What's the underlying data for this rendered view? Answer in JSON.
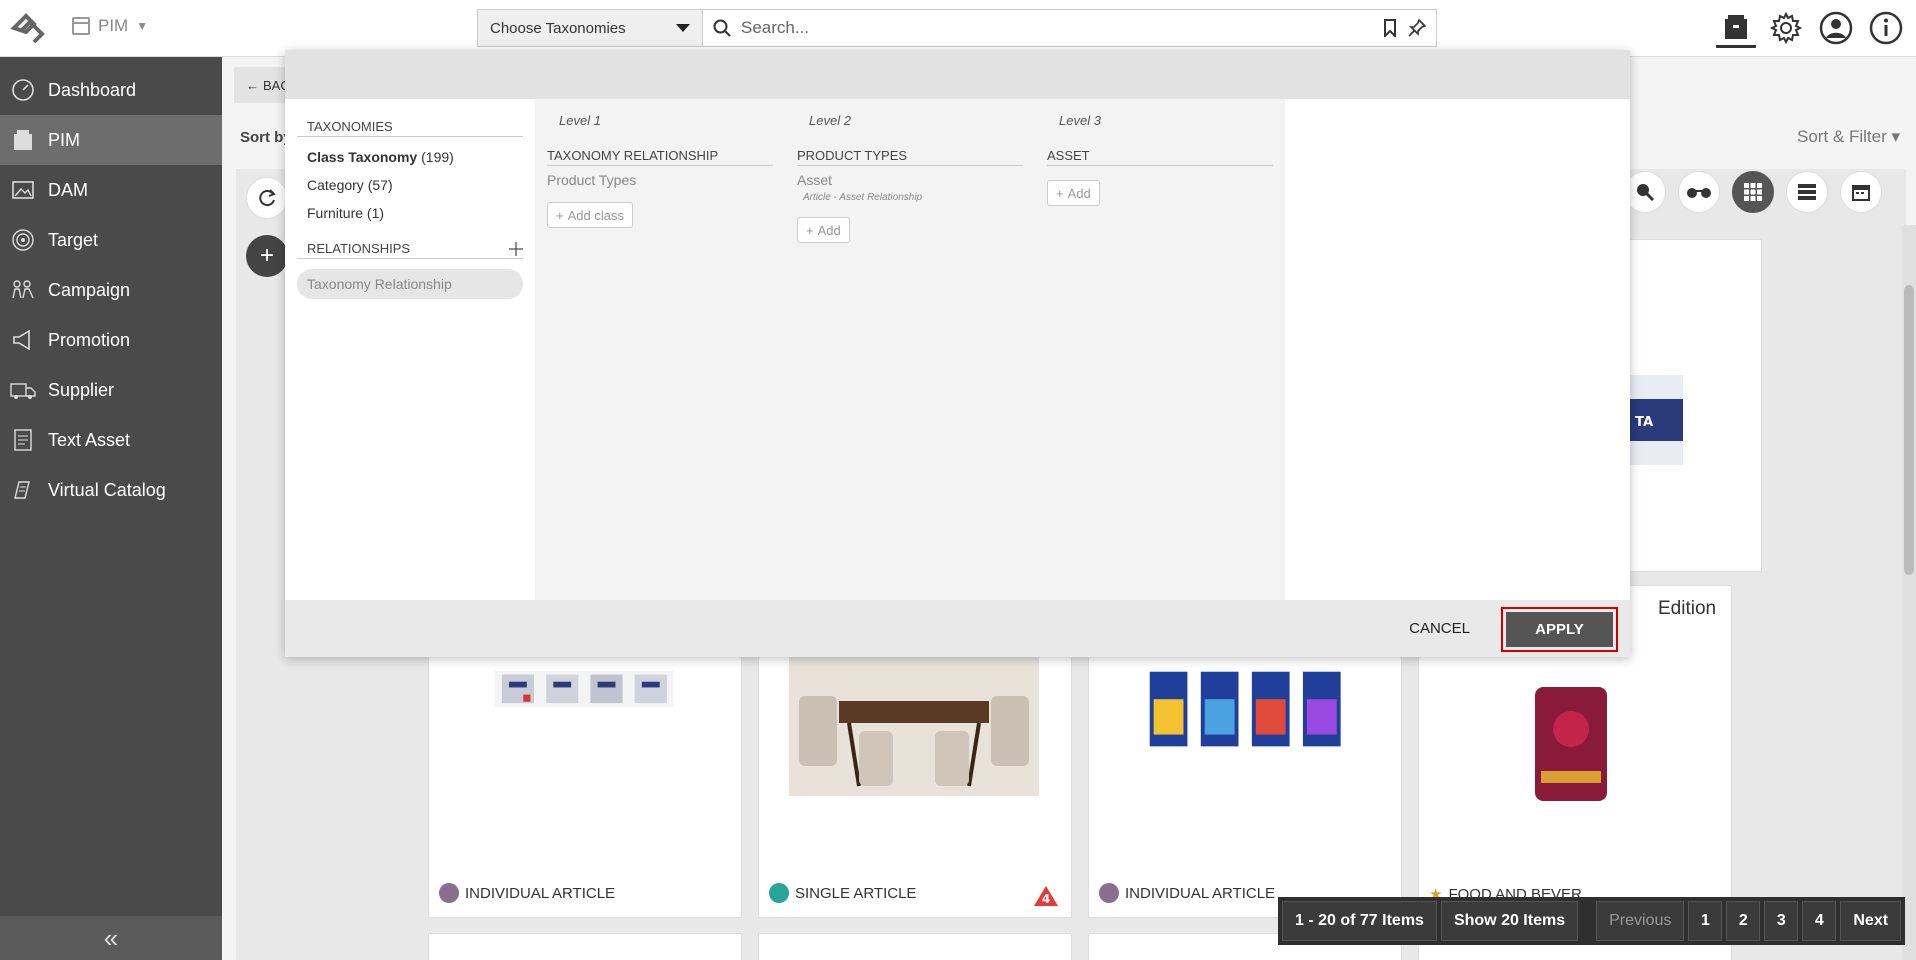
{
  "topbar": {
    "module_label": "PIM",
    "taxonomy_select": "Choose Taxonomies",
    "search_placeholder": "Search..."
  },
  "sidebar": {
    "items": [
      {
        "label": "Dashboard",
        "icon": "dashboard-icon"
      },
      {
        "label": "PIM",
        "icon": "pim-icon"
      },
      {
        "label": "DAM",
        "icon": "dam-icon"
      },
      {
        "label": "Target",
        "icon": "target-icon"
      },
      {
        "label": "Campaign",
        "icon": "campaign-icon"
      },
      {
        "label": "Promotion",
        "icon": "promotion-icon"
      },
      {
        "label": "Supplier",
        "icon": "supplier-icon"
      },
      {
        "label": "Text Asset",
        "icon": "text-asset-icon"
      },
      {
        "label": "Virtual Catalog",
        "icon": "virtual-catalog-icon"
      }
    ],
    "active": "PIM",
    "collapse_label": "«"
  },
  "main": {
    "back_label": "BAC",
    "sort_by": "Sort by",
    "sort_filter": "Sort & Filter ▾",
    "cards": [
      {
        "type": "INDIVIDUAL ARTICLE"
      },
      {
        "type": "SINGLE ARTICLE",
        "badge": "4"
      },
      {
        "type": "INDIVIDUAL ARTICLE"
      },
      {
        "type": "FOOD AND BEVER..."
      }
    ],
    "edition_title": "Edition"
  },
  "pager": {
    "info": "1 - 20 of 77 Items",
    "show": "Show 20 Items",
    "previous": "Previous",
    "pages": [
      "1",
      "2",
      "3",
      "4"
    ],
    "next": "Next"
  },
  "modal": {
    "taxonomies_title": "TAXONOMIES",
    "taxonomies": [
      {
        "name": "Class Taxonomy",
        "count": "(199)",
        "bold": true
      },
      {
        "name": "Category",
        "count": "(57)",
        "bold": false
      },
      {
        "name": "Furniture",
        "count": "(1)",
        "bold": false
      }
    ],
    "relationships_title": "RELATIONSHIPS",
    "relationship_item": "Taxonomy Relationship",
    "levels": [
      {
        "label": "Level 1",
        "head": "TAXONOMY RELATIONSHIP",
        "value": "Product Types",
        "sub": "",
        "add": "Add class"
      },
      {
        "label": "Level 2",
        "head": "PRODUCT TYPES",
        "value": "Asset",
        "sub": "Article - Asset Relationship",
        "add": "Add"
      },
      {
        "label": "Level 3",
        "head": "ASSET",
        "value": "",
        "sub": "",
        "add": "Add"
      }
    ],
    "cancel": "CANCEL",
    "apply": "APPLY"
  },
  "colors": {
    "sidebar": "#4a4a4a",
    "sidebar_active": "#6d6d6d",
    "apply_highlight": "#d10000",
    "apply_button": "#555555"
  }
}
